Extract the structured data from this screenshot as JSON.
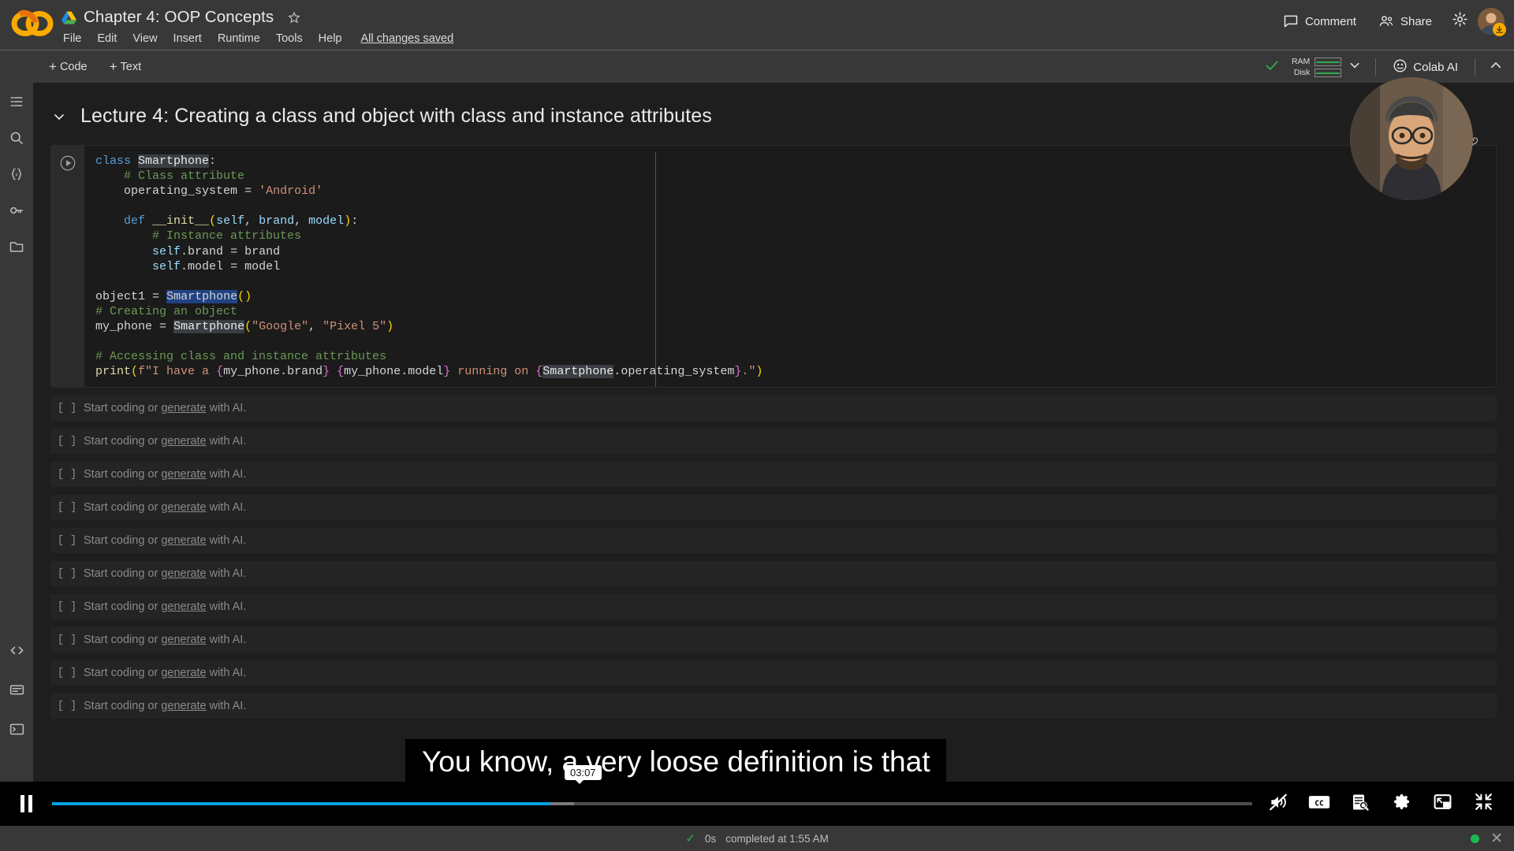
{
  "app": {
    "name": "Google Colab",
    "logo_icon": "colab-logo-icon"
  },
  "titlebar": {
    "drive_icon": "google-drive-icon",
    "document_title": "Chapter 4: OOP Concepts",
    "star_icon": "star-outline-icon",
    "menus": [
      "File",
      "Edit",
      "View",
      "Insert",
      "Runtime",
      "Tools",
      "Help"
    ],
    "save_status": "All changes saved",
    "comment_label": "Comment",
    "comment_icon": "comment-icon",
    "share_label": "Share",
    "share_icon": "share-people-icon",
    "settings_icon": "gear-icon",
    "avatar": "user-avatar",
    "avatar_badge_icon": "download-badge-icon"
  },
  "toolbar": {
    "add_code_label": "Code",
    "add_text_label": "Text",
    "add_icon": "plus-icon",
    "connected_icon": "checkmark-icon",
    "ram_label": "RAM",
    "disk_label": "Disk",
    "resource_chevron_icon": "chevron-down-icon",
    "colab_ai_label": "Colab AI",
    "colab_ai_icon": "colab-ai-face-icon",
    "collapse_icon": "chevron-up-icon"
  },
  "left_rail": {
    "items": [
      {
        "icon": "table-of-contents-icon",
        "name": "toc"
      },
      {
        "icon": "search-icon",
        "name": "find-replace"
      },
      {
        "icon": "variables-braces-icon",
        "name": "variables"
      },
      {
        "icon": "secrets-key-icon",
        "name": "secrets"
      },
      {
        "icon": "files-folder-icon",
        "name": "files"
      }
    ],
    "bottom_items": [
      {
        "icon": "code-snippets-icon",
        "name": "code-snippets"
      },
      {
        "icon": "terminal-icon",
        "name": "terminal"
      },
      {
        "icon": "command-palette-icon",
        "name": "command-palette"
      }
    ]
  },
  "notebook": {
    "section_title": "Lecture 4: Creating a class and object with class and instance attributes",
    "section_chevron_icon": "chevron-down-icon",
    "cell_tools": [
      {
        "icon": "move-cell-up-icon",
        "name": "move-cell-up"
      },
      {
        "icon": "move-cell-down-icon",
        "name": "move-cell-down"
      },
      {
        "icon": "link-to-cell-icon",
        "name": "link-to-cell"
      }
    ],
    "run_icon": "run-cell-play-icon",
    "code_lines": [
      "class Smartphone:",
      "    # Class attribute",
      "    operating_system = 'Android'",
      "",
      "    def __init__(self, brand, model):",
      "        # Instance attributes",
      "        self.brand = brand",
      "        self.model = model",
      "",
      "object1 = Smartphone()",
      "# Creating an object",
      "my_phone = Smartphone(\"Google\", \"Pixel 5\")",
      "",
      "# Accessing class and instance attributes",
      "print(f\"I have a {my_phone.brand} {my_phone.model} running on {Smartphone.operating_system}.\")"
    ],
    "selected_text": "Smartphone",
    "empty_cell_index": "[ ]",
    "empty_cell_prefix": "Start coding or ",
    "empty_cell_link": "generate",
    "empty_cell_suffix": " with AI.",
    "empty_cell_count": 10
  },
  "video": {
    "caption_text": "You know, a very loose definition is that",
    "time_tooltip": "03:07",
    "play_pause_icon": "pause-icon",
    "progress_percent": 41.5,
    "buffered_percent": 43.5,
    "controls": [
      {
        "icon": "mute-volume-off-icon",
        "name": "mute-toggle"
      },
      {
        "icon": "closed-captions-cc-icon",
        "name": "captions-toggle"
      },
      {
        "icon": "transcript-search-icon",
        "name": "transcript"
      },
      {
        "icon": "gear-icon",
        "name": "video-settings"
      },
      {
        "icon": "picture-in-picture-icon",
        "name": "picture-in-picture"
      },
      {
        "icon": "exit-fullscreen-icon",
        "name": "exit-fullscreen"
      }
    ]
  },
  "statusbar": {
    "check_icon": "checkmark-icon",
    "duration": "0s",
    "completed_text": "completed at 1:55 AM",
    "recording_dot": "recording-indicator",
    "close_icon": "close-x-icon"
  },
  "colors": {
    "accent_blue": "#00a3e0",
    "selection_blue": "#214283",
    "green": "#34a853",
    "amber": "#f9ab00",
    "panel": "#383838",
    "canvas": "#1e1e1e"
  }
}
